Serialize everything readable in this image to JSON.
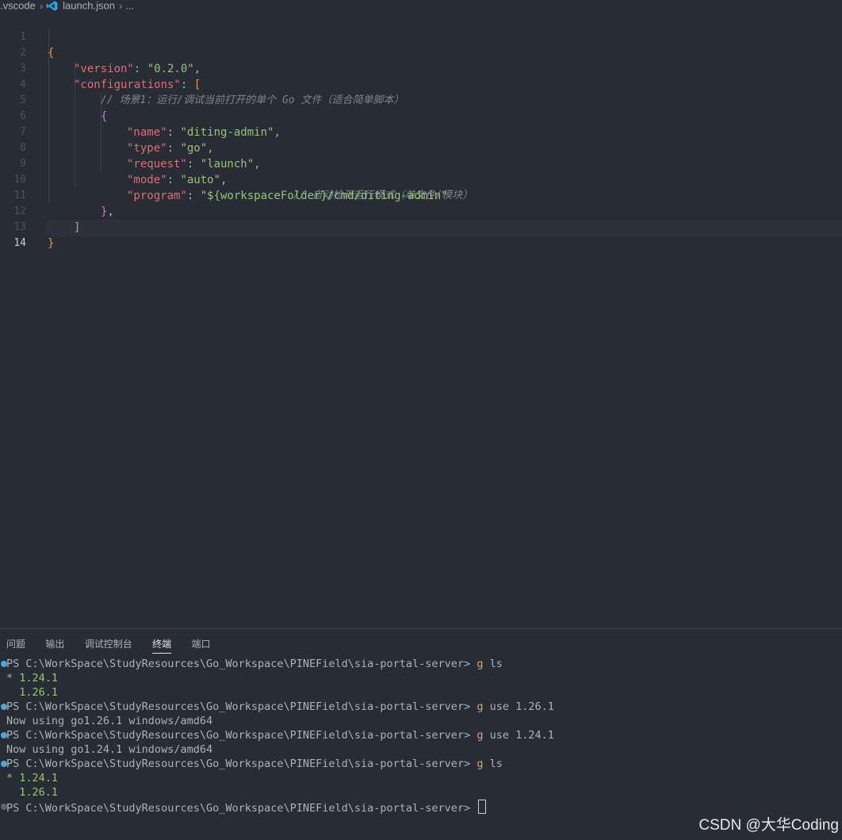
{
  "breadcrumb": {
    "folder": ".vscode",
    "file": "launch.json",
    "more": "..."
  },
  "editor": {
    "line_numbers": [
      "1",
      "2",
      "3",
      "4",
      "5",
      "6",
      "7",
      "8",
      "9",
      "10",
      "11",
      "12",
      "13",
      "14"
    ],
    "active_line": "14",
    "tokens": {
      "l1_open": "{",
      "l2_key": "\"version\"",
      "l2_colon": ": ",
      "l2_val": "\"0.2.0\"",
      "l2_comma": ",",
      "l3_key": "\"configurations\"",
      "l3_colon": ": ",
      "l3_open": "[",
      "l4_comment": "// 场景1：运行/调试当前打开的单个 Go 文件（适合简单脚本）",
      "l5_open": "{",
      "l6_key": "\"name\"",
      "l6_colon": ": ",
      "l6_val": "\"diting-admin\"",
      "l6_comma": ",",
      "l7_key": "\"type\"",
      "l7_colon": ": ",
      "l7_val": "\"go\"",
      "l7_comma": ",",
      "l8_key": "\"request\"",
      "l8_colon": ": ",
      "l8_val": "\"launch\"",
      "l8_comma": ",",
      "l9_key": "\"mode\"",
      "l9_colon": ": ",
      "l9_val": "\"auto\"",
      "l9_comma": ",",
      "l9_comment": "// 自动检测运行模式（单文件/模块）",
      "l10_key": "\"program\"",
      "l10_colon": ": ",
      "l10_val": "\"${workspaceFolder}/cmd/diting-admin\"",
      "l11_close": "}",
      "l11_comma": ",",
      "l12_close": "]",
      "l13_close": "}"
    }
  },
  "panel": {
    "tabs": [
      "问题",
      "输出",
      "调试控制台",
      "终端",
      "端口"
    ],
    "active_tab": "终端"
  },
  "terminal": {
    "prompt": "PS C:\\WorkSpace\\StudyResources\\Go_Workspace\\PINEField\\sia-portal-server> ",
    "cmd1": "g",
    "cmd1_args": " ls",
    "out1a": "* 1.24.1",
    "out1b": "  1.26.1",
    "cmd2": "g",
    "cmd2_args": " use 1.26.1",
    "out2": "Now using go1.26.1 windows/amd64",
    "cmd3": "g",
    "cmd3_args": " use 1.24.1",
    "out3": "Now using go1.24.1 windows/amd64",
    "cmd4": "g",
    "cmd4_args": " ls",
    "out4a": "* 1.24.1",
    "out4b": "  1.26.1"
  },
  "watermark": "CSDN @大华Coding",
  "colors": {
    "background": "#282c34",
    "key": "#e06c75",
    "string": "#98c379",
    "comment": "#7f848e",
    "command": "#e5a562",
    "prompt_dot": "#4aa7d6"
  }
}
